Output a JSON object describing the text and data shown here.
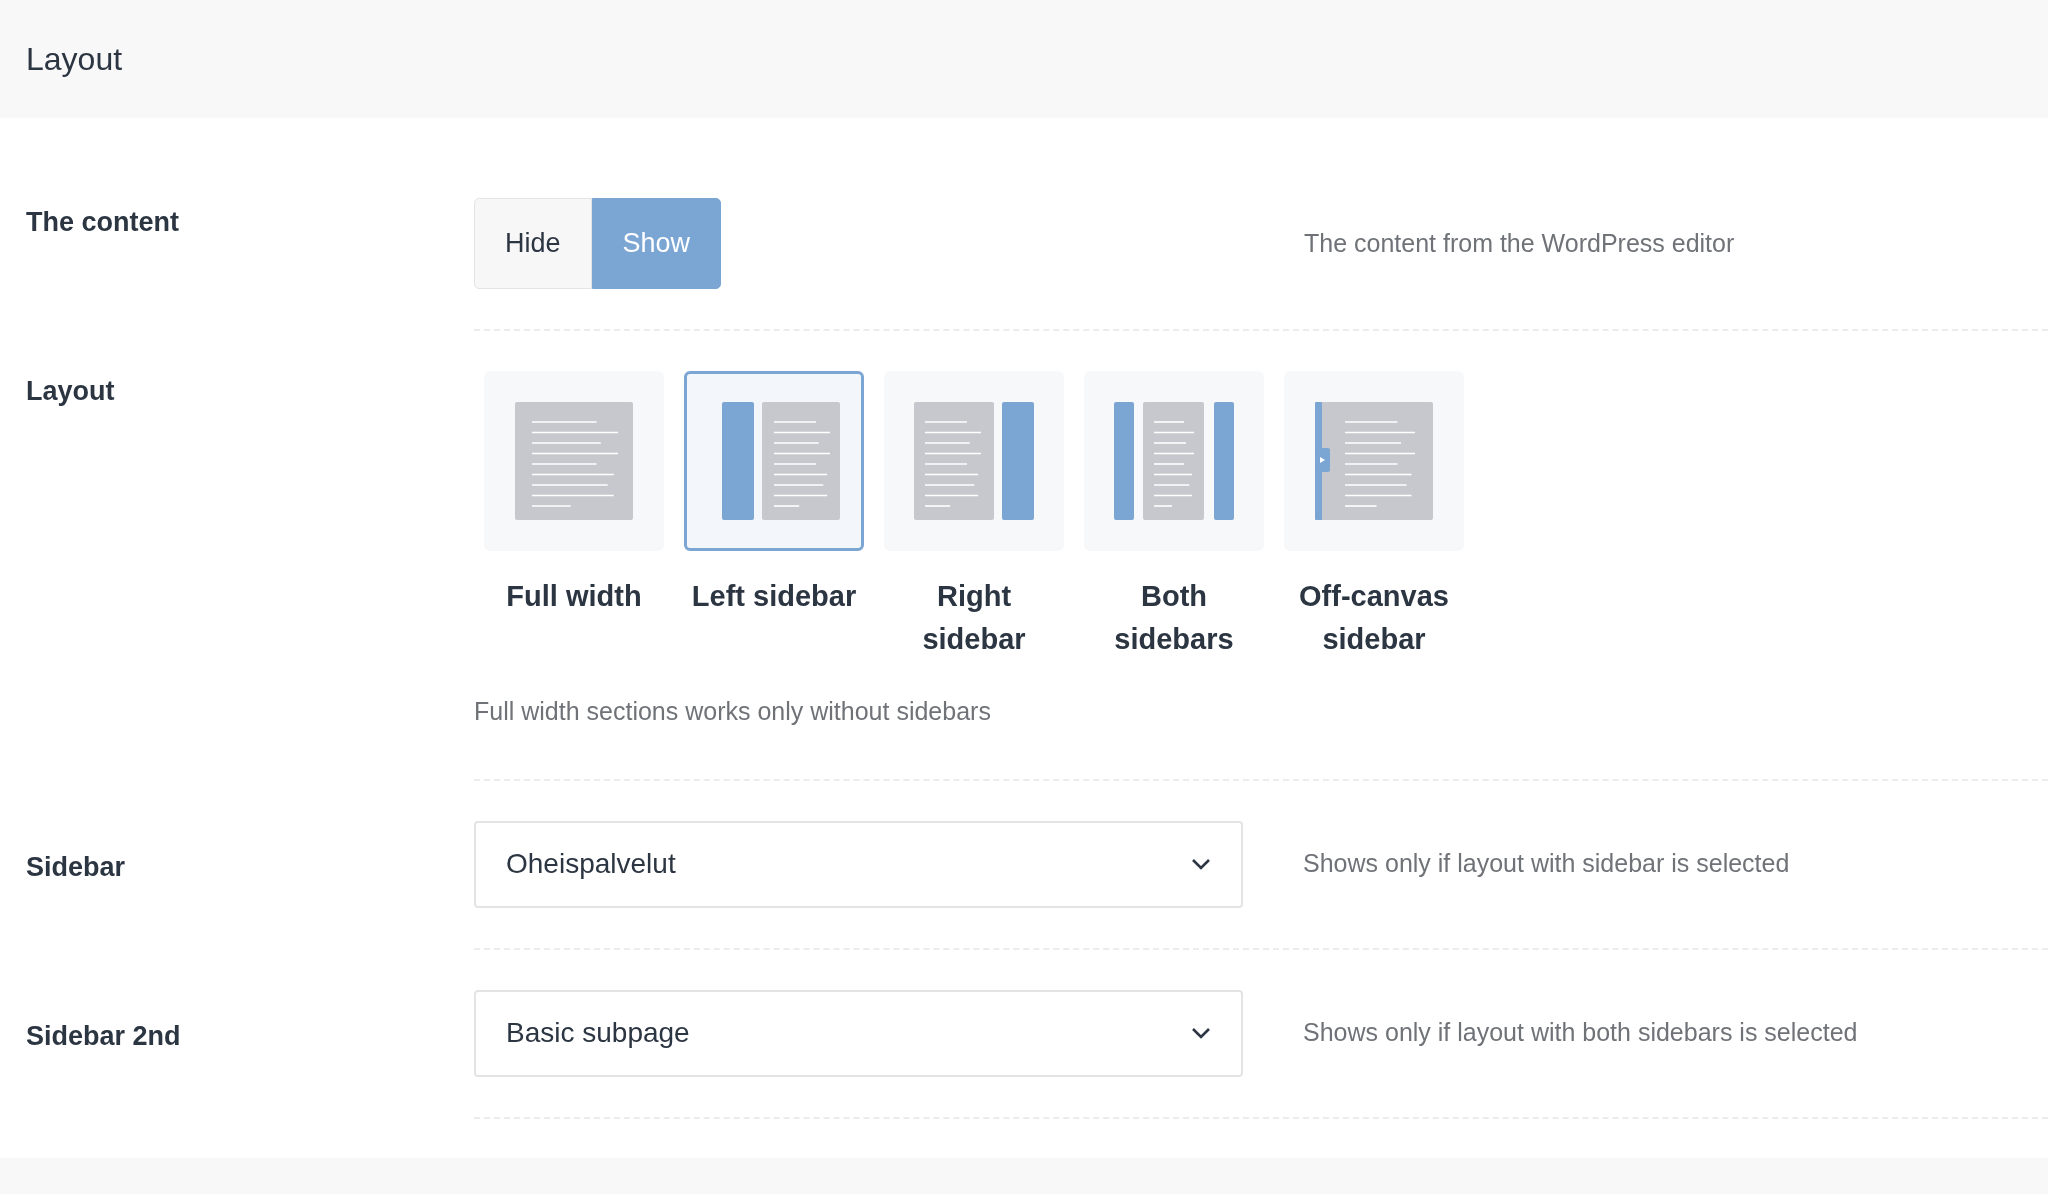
{
  "header": {
    "title": "Layout"
  },
  "content_row": {
    "label": "The content",
    "options": [
      {
        "label": "Hide",
        "selected": false
      },
      {
        "label": "Show",
        "selected": true
      }
    ],
    "description": "The content from the WordPress editor"
  },
  "layout_row": {
    "label": "Layout",
    "options": [
      {
        "kind": "full",
        "label": "Full width",
        "selected": false
      },
      {
        "kind": "left",
        "label": "Left sidebar",
        "selected": true
      },
      {
        "kind": "right",
        "label": "Right sidebar",
        "selected": false
      },
      {
        "kind": "both",
        "label": "Both sidebars",
        "selected": false
      },
      {
        "kind": "offcanvas",
        "label": "Off-canvas sidebar",
        "selected": false
      }
    ],
    "note": "Full width sections works only without sidebars"
  },
  "selects": [
    {
      "label": "Sidebar",
      "value": "Oheispalvelut",
      "description": "Shows only if layout with sidebar is selected"
    },
    {
      "label": "Sidebar 2nd",
      "value": "Basic subpage",
      "description": "Shows only if layout with both sidebars is selected"
    }
  ]
}
